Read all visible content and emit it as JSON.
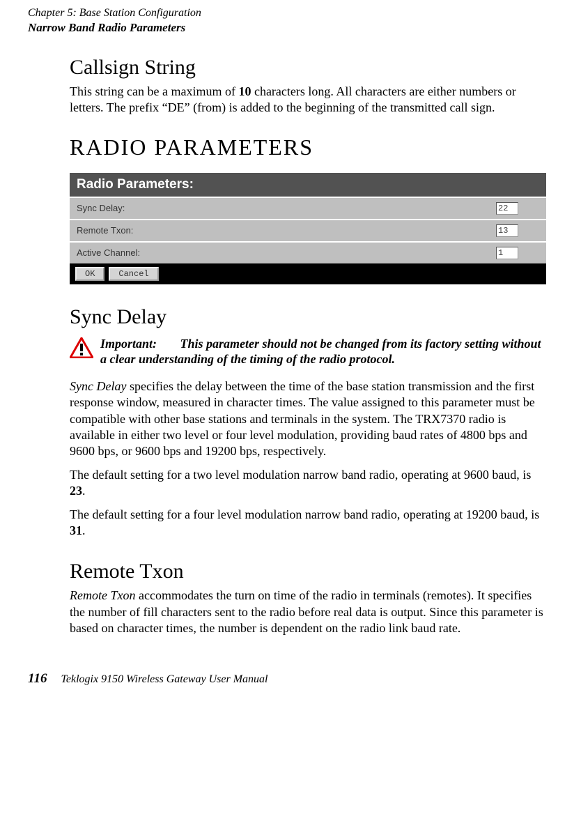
{
  "header": {
    "chapter": "Chapter 5:  Base Station Configuration",
    "section": "Narrow Band Radio Parameters"
  },
  "callsign": {
    "title": "Callsign String",
    "p1_a": "This string can be a maximum of ",
    "p1_bold": "10",
    "p1_b": " characters long. All characters are either numbers or letters. The prefix “DE” (from) is added to the beginning of the transmitted call sign."
  },
  "radio": {
    "heading": "RADIO PARAMETERS",
    "panel_title": "Radio Parameters:",
    "rows": [
      {
        "label": "Sync Delay:",
        "value": "22"
      },
      {
        "label": "Remote Txon:",
        "value": "13"
      },
      {
        "label": "Active Channel:",
        "value": "1"
      }
    ],
    "ok": "OK",
    "cancel": "Cancel"
  },
  "sync": {
    "title": "Sync Delay",
    "important_label": "Important:",
    "important_text": "This parameter should not be changed from its factory setting without a clear understanding of the timing of the radio protocol.",
    "p1_em": "Sync Delay",
    "p1_rest": " specifies the delay between the time of the base station transmission and the first response window, measured in character times. The value assigned to this parameter must be compatible with other base stations and terminals in the system. The TRX7370 radio is available in either two level or four level modulation, providing baud rates of 4800 bps and 9600 bps, or 9600 bps and 19200 bps, respectively.",
    "p2_a": "The default setting for a two level modulation narrow band radio, operating at 9600 baud, is ",
    "p2_bold": "23",
    "p2_b": ".",
    "p3_a": "The default setting for a four level modulation narrow band radio, operating at 19200 baud, is ",
    "p3_bold": "31",
    "p3_b": "."
  },
  "remote": {
    "title": "Remote Txon",
    "p1_em": "Remote Txon",
    "p1_rest": " accommodates the turn on time of the radio in terminals (remotes). It specifies the number of fill characters sent to the radio before real data is output. Since this parameter is based on character times, the number is dependent on the radio link baud rate."
  },
  "footer": {
    "page": "116",
    "title": "Teklogix 9150 Wireless Gateway User Manual"
  }
}
